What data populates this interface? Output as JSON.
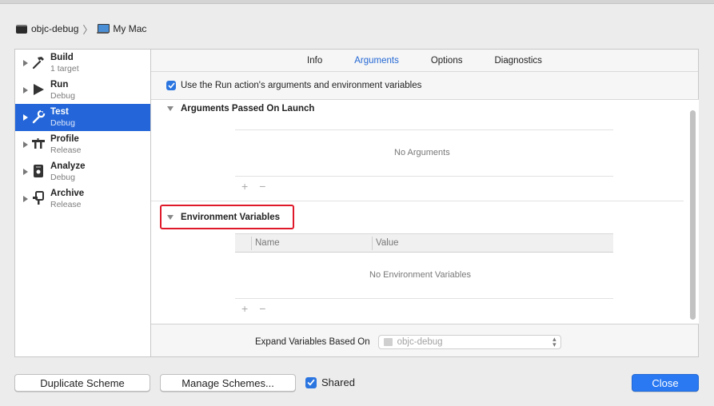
{
  "breadcrumb": {
    "scheme": "objc-debug",
    "destination": "My Mac"
  },
  "actions": [
    {
      "title": "Build",
      "subtitle": "1 target",
      "icon": "hammer-icon"
    },
    {
      "title": "Run",
      "subtitle": "Debug",
      "icon": "play-icon"
    },
    {
      "title": "Test",
      "subtitle": "Debug",
      "icon": "wrench-icon"
    },
    {
      "title": "Profile",
      "subtitle": "Release",
      "icon": "instruments-icon"
    },
    {
      "title": "Analyze",
      "subtitle": "Debug",
      "icon": "analyze-icon"
    },
    {
      "title": "Archive",
      "subtitle": "Release",
      "icon": "archive-icon"
    }
  ],
  "selected_action": "Test",
  "tabs": [
    {
      "label": "Info",
      "active": false
    },
    {
      "label": "Arguments",
      "active": true
    },
    {
      "label": "Options",
      "active": false
    },
    {
      "label": "Diagnostics",
      "active": false
    }
  ],
  "use_run_args": {
    "label": "Use the Run action's arguments and environment variables",
    "checked": true
  },
  "arguments_section": {
    "title": "Arguments Passed On Launch",
    "empty_text": "No Arguments"
  },
  "env_section": {
    "title": "Environment Variables",
    "columns": [
      "Name",
      "Value"
    ],
    "empty_text": "No Environment Variables"
  },
  "add_symbol": "+",
  "remove_symbol": "−",
  "expand_variables": {
    "label": "Expand Variables Based On",
    "value": "objc-debug"
  },
  "footer": {
    "duplicate_label": "Duplicate Scheme",
    "manage_label": "Manage Schemes...",
    "shared_label": "Shared",
    "shared_checked": true,
    "close_label": "Close"
  },
  "colors": {
    "accent": "#2466d9",
    "highlight_border": "#e0192a",
    "primary_button": "#2a79f2"
  }
}
